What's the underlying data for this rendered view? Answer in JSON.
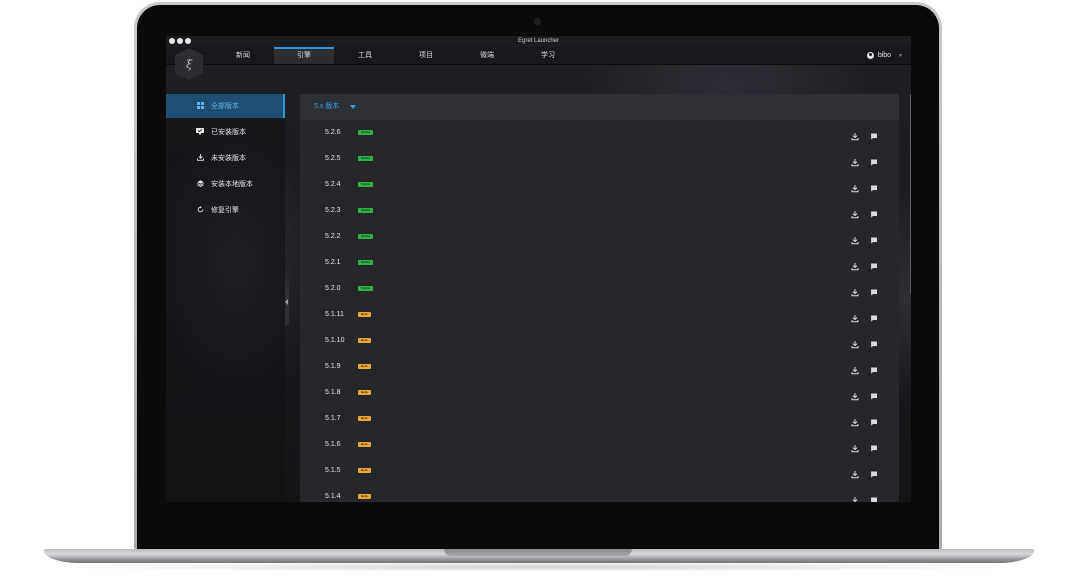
{
  "window": {
    "title": "Egret Launcher"
  },
  "nav": {
    "tabs": [
      {
        "label": "新闻"
      },
      {
        "label": "引擎"
      },
      {
        "label": "工具"
      },
      {
        "label": "项目"
      },
      {
        "label": "微端"
      },
      {
        "label": "学习"
      }
    ],
    "active_tab": "引擎",
    "user_name": "bibo"
  },
  "sidebar": {
    "items": [
      {
        "label": "全部版本",
        "icon": "grid-icon"
      },
      {
        "label": "已安装版本",
        "icon": "monitor-check-icon"
      },
      {
        "label": "未安装版本",
        "icon": "download-icon"
      },
      {
        "label": "安装本地版本",
        "icon": "layers-icon"
      },
      {
        "label": "修复引擎",
        "icon": "refresh-icon"
      }
    ],
    "active_item": "全部版本"
  },
  "main": {
    "filter_label": "5.x 版本",
    "versions": [
      {
        "version": "5.2.6",
        "badge": "Stable"
      },
      {
        "version": "5.2.5",
        "badge": "Stable"
      },
      {
        "version": "5.2.4",
        "badge": "Stable"
      },
      {
        "version": "5.2.3",
        "badge": "Stable"
      },
      {
        "version": "5.2.2",
        "badge": "Stable"
      },
      {
        "version": "5.2.1",
        "badge": "Stable"
      },
      {
        "version": "5.2.0",
        "badge": "Stable"
      },
      {
        "version": "5.1.11",
        "badge": "Beta"
      },
      {
        "version": "5.1.10",
        "badge": "Beta"
      },
      {
        "version": "5.1.9",
        "badge": "Beta"
      },
      {
        "version": "5.1.8",
        "badge": "Beta"
      },
      {
        "version": "5.1.7",
        "badge": "Beta"
      },
      {
        "version": "5.1.6",
        "badge": "Beta"
      },
      {
        "version": "5.1.5",
        "badge": "Beta"
      },
      {
        "version": "5.1.4",
        "badge": "Beta"
      }
    ]
  },
  "colors": {
    "accent": "#2f95d6",
    "stable": "#2fb344",
    "beta": "#e8a63c",
    "panel": "#25272b"
  }
}
